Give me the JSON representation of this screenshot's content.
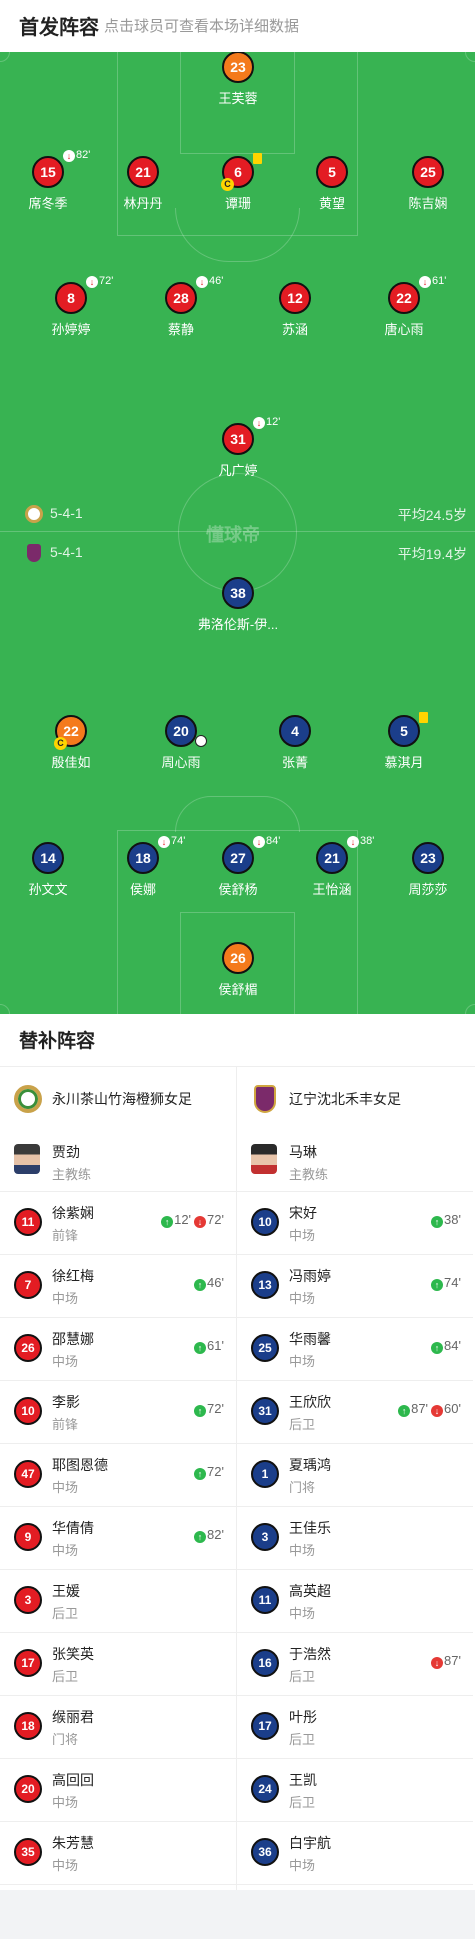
{
  "header": {
    "title": "首发阵容",
    "subtitle": "点击球员可查看本场详细数据"
  },
  "pitch": {
    "watermark": "懂球帝",
    "home": {
      "formation": "5-4-1",
      "avg_age": "平均24.5岁"
    },
    "away": {
      "formation": "5-4-1",
      "avg_age": "平均19.4岁"
    },
    "players": {
      "p23": {
        "number": "23",
        "name": "王芙蓉"
      },
      "p15": {
        "number": "15",
        "name": "席冬季",
        "sub_out": "82'"
      },
      "p21": {
        "number": "21",
        "name": "林丹丹"
      },
      "p6": {
        "number": "6",
        "name": "谭珊",
        "captain": "C"
      },
      "p5": {
        "number": "5",
        "name": "黄望"
      },
      "p25": {
        "number": "25",
        "name": "陈吉娴"
      },
      "p8": {
        "number": "8",
        "name": "孙婷婷",
        "sub_out": "72'"
      },
      "p28": {
        "number": "28",
        "name": "蔡静",
        "sub_out": "46'"
      },
      "p12": {
        "number": "12",
        "name": "苏涵"
      },
      "p22": {
        "number": "22",
        "name": "唐心雨",
        "sub_out": "61'"
      },
      "p31": {
        "number": "31",
        "name": "凡广婷",
        "sub_out": "12'"
      },
      "a38": {
        "number": "38",
        "name": "弗洛伦斯-伊..."
      },
      "a22": {
        "number": "22",
        "name": "殷佳如",
        "captain": "C"
      },
      "a20": {
        "number": "20",
        "name": "周心雨"
      },
      "a4": {
        "number": "4",
        "name": "张菁"
      },
      "a5": {
        "number": "5",
        "name": "慕淇月"
      },
      "a14": {
        "number": "14",
        "name": "孙文文"
      },
      "a18": {
        "number": "18",
        "name": "侯娜",
        "sub_out": "74'"
      },
      "a27": {
        "number": "27",
        "name": "侯舒杨",
        "sub_out": "84'"
      },
      "a21": {
        "number": "21",
        "name": "王怡涵",
        "sub_out": "38'"
      },
      "a23": {
        "number": "23",
        "name": "周莎莎"
      },
      "a26": {
        "number": "26",
        "name": "侯舒楣"
      }
    }
  },
  "bench": {
    "title": "替补阵容",
    "home": {
      "team_name": "永川茶山竹海橙狮女足",
      "coach": {
        "name": "贾劲",
        "role": "主教练"
      },
      "players": [
        {
          "number": "11",
          "name": "徐紫娴",
          "position": "前锋",
          "sub_in": "12'",
          "sub_out": "72'"
        },
        {
          "number": "7",
          "name": "徐红梅",
          "position": "中场",
          "sub_in": "46'"
        },
        {
          "number": "26",
          "name": "邵慧娜",
          "position": "中场",
          "sub_in": "61'"
        },
        {
          "number": "10",
          "name": "李影",
          "position": "前锋",
          "sub_in": "72'"
        },
        {
          "number": "47",
          "name": "耶图恩德",
          "position": "中场",
          "sub_in": "72'"
        },
        {
          "number": "9",
          "name": "华倩倩",
          "position": "中场",
          "sub_in": "82'"
        },
        {
          "number": "3",
          "name": "王媛",
          "position": "后卫"
        },
        {
          "number": "17",
          "name": "张笑英",
          "position": "后卫"
        },
        {
          "number": "18",
          "name": "缑丽君",
          "position": "门将"
        },
        {
          "number": "20",
          "name": "高回回",
          "position": "中场"
        },
        {
          "number": "35",
          "name": "朱芳慧",
          "position": "中场"
        }
      ]
    },
    "away": {
      "team_name": "辽宁沈北禾丰女足",
      "coach": {
        "name": "马琳",
        "role": "主教练"
      },
      "players": [
        {
          "number": "10",
          "name": "宋好",
          "position": "中场",
          "sub_in": "38'"
        },
        {
          "number": "13",
          "name": "冯雨婷",
          "position": "中场",
          "sub_in": "74'"
        },
        {
          "number": "25",
          "name": "华雨馨",
          "position": "中场",
          "sub_in": "84'"
        },
        {
          "number": "31",
          "name": "王欣欣",
          "position": "后卫",
          "sub_in": "87'",
          "sub_out": "60'"
        },
        {
          "number": "1",
          "name": "夏瑀鸿",
          "position": "门将"
        },
        {
          "number": "3",
          "name": "王佳乐",
          "position": "中场"
        },
        {
          "number": "11",
          "name": "高英超",
          "position": "中场"
        },
        {
          "number": "16",
          "name": "于浩然",
          "position": "后卫",
          "sub_out": "87'"
        },
        {
          "number": "17",
          "name": "叶彤",
          "position": "后卫"
        },
        {
          "number": "24",
          "name": "王凯",
          "position": "后卫"
        },
        {
          "number": "36",
          "name": "白宇航",
          "position": "中场"
        }
      ]
    }
  },
  "colors": {
    "pitch": "#38b352",
    "home": "#e31c23",
    "goalkeeper_home": "#f47a1c",
    "away": "#1b3e8a",
    "sub_in": "#2db84d",
    "sub_out": "#e53935",
    "card": "#ffd400"
  },
  "icons": {
    "sub_in": "arrow-up-icon",
    "sub_out": "arrow-down-icon",
    "goal": "soccer-ball-icon",
    "card": "yellow-card-icon",
    "captain": "captain-badge-icon"
  }
}
